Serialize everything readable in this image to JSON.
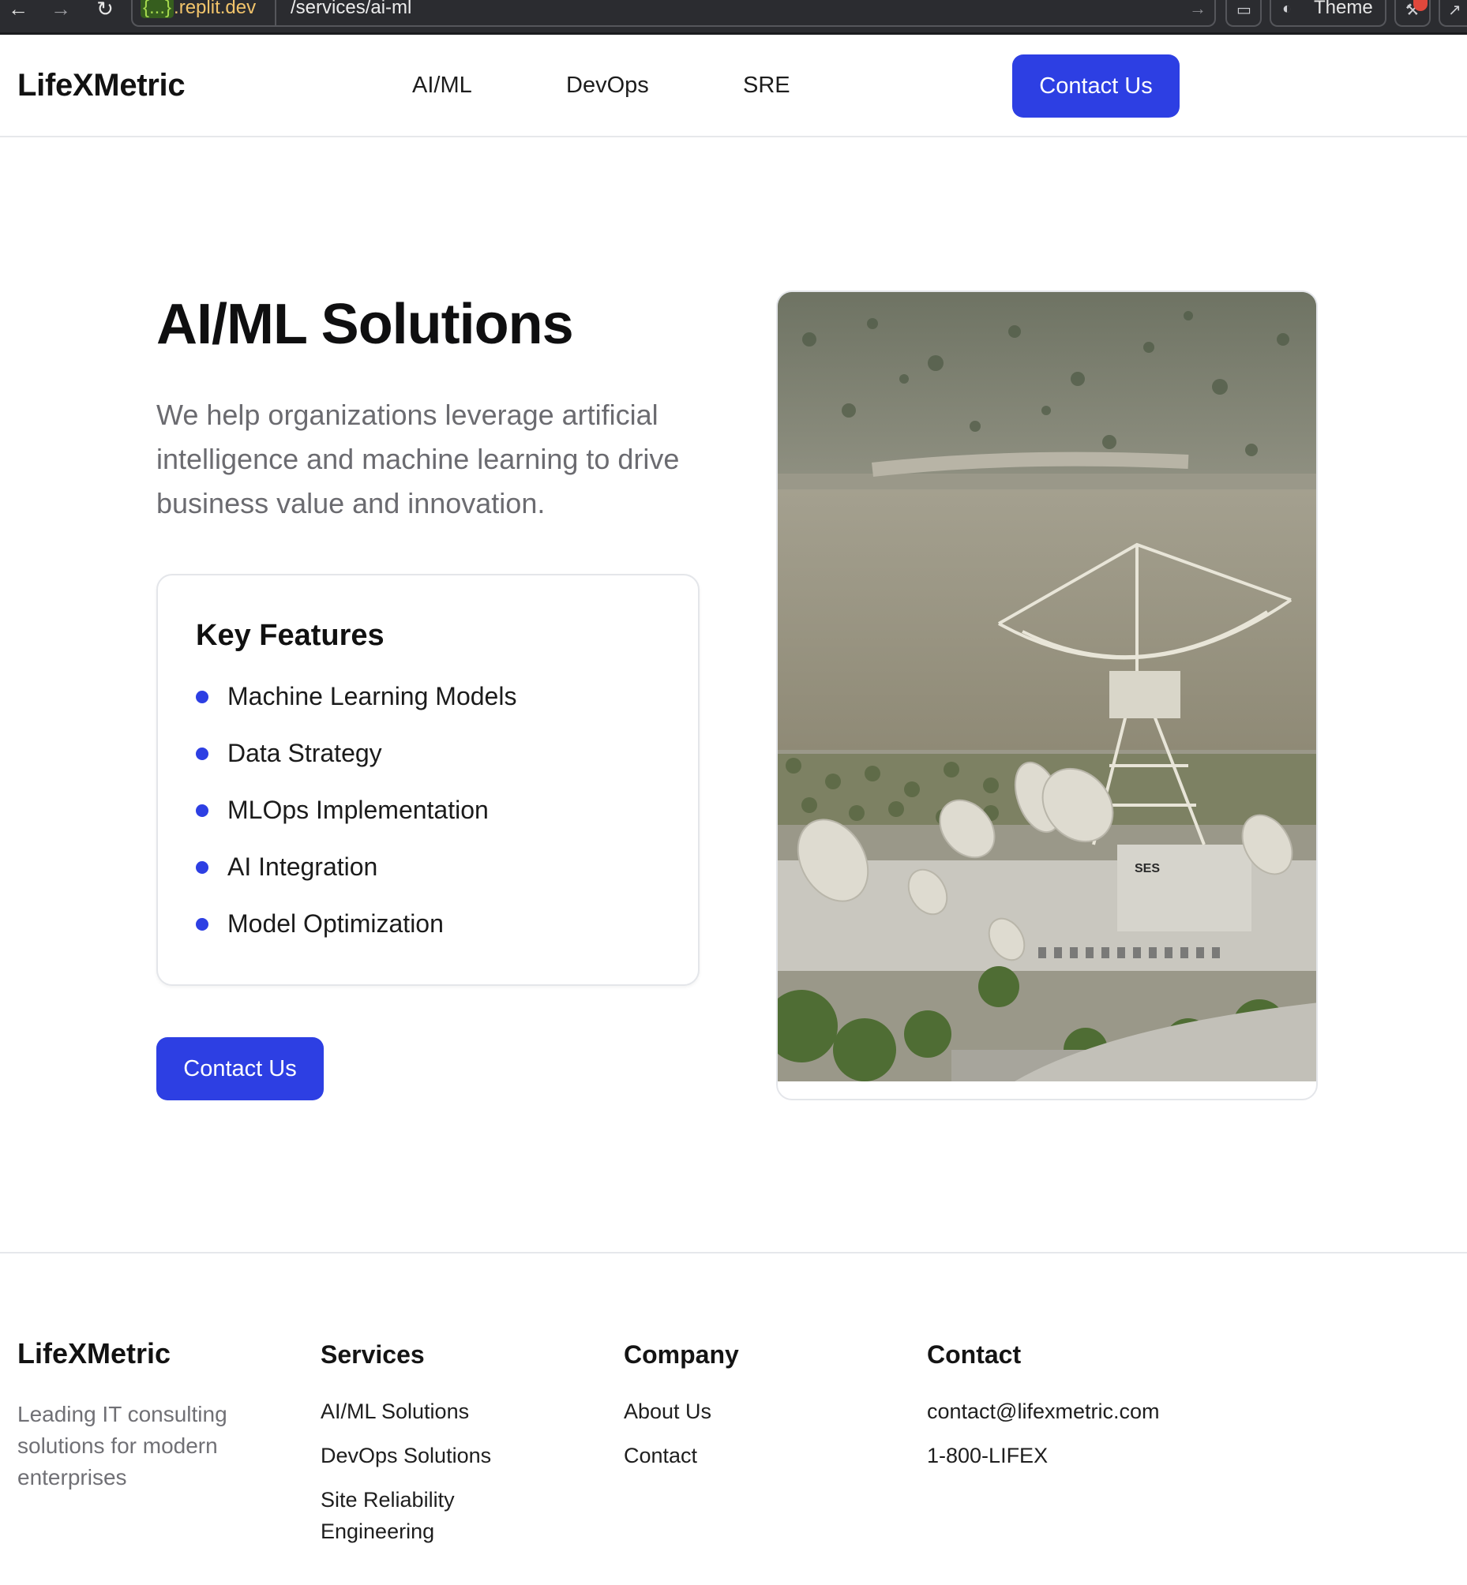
{
  "browser": {
    "url_host_brace": "{...}",
    "url_host": ".replit.dev",
    "url_path": "/services/ai-ml",
    "theme_label": "Theme"
  },
  "header": {
    "logo": "LifeXMetric",
    "nav": [
      "AI/ML",
      "DevOps",
      "SRE"
    ],
    "cta_label": "Contact Us"
  },
  "hero": {
    "title": "AI/ML Solutions",
    "description": "We help organizations leverage artificial intelligence and machine learning to drive business value and innovation.",
    "features_title": "Key Features",
    "features": [
      "Machine Learning Models",
      "Data Strategy",
      "MLOps Implementation",
      "AI Integration",
      "Model Optimization"
    ],
    "cta_label": "Contact Us",
    "image_sign_text": "SES"
  },
  "footer": {
    "logo": "LifeXMetric",
    "tagline": "Leading IT consulting solutions for modern enterprises",
    "services_title": "Services",
    "services_links": [
      "AI/ML Solutions",
      "DevOps Solutions",
      "Site Reliability Engineering"
    ],
    "company_title": "Company",
    "company_links": [
      "About Us",
      "Contact"
    ],
    "contact_title": "Contact",
    "contact_email": "contact@lifexmetric.com",
    "contact_phone": "1-800-LIFEX"
  },
  "colors": {
    "accent": "#2d3fe3",
    "muted_text": "#6b6b70",
    "border": "#e4e6ea"
  }
}
